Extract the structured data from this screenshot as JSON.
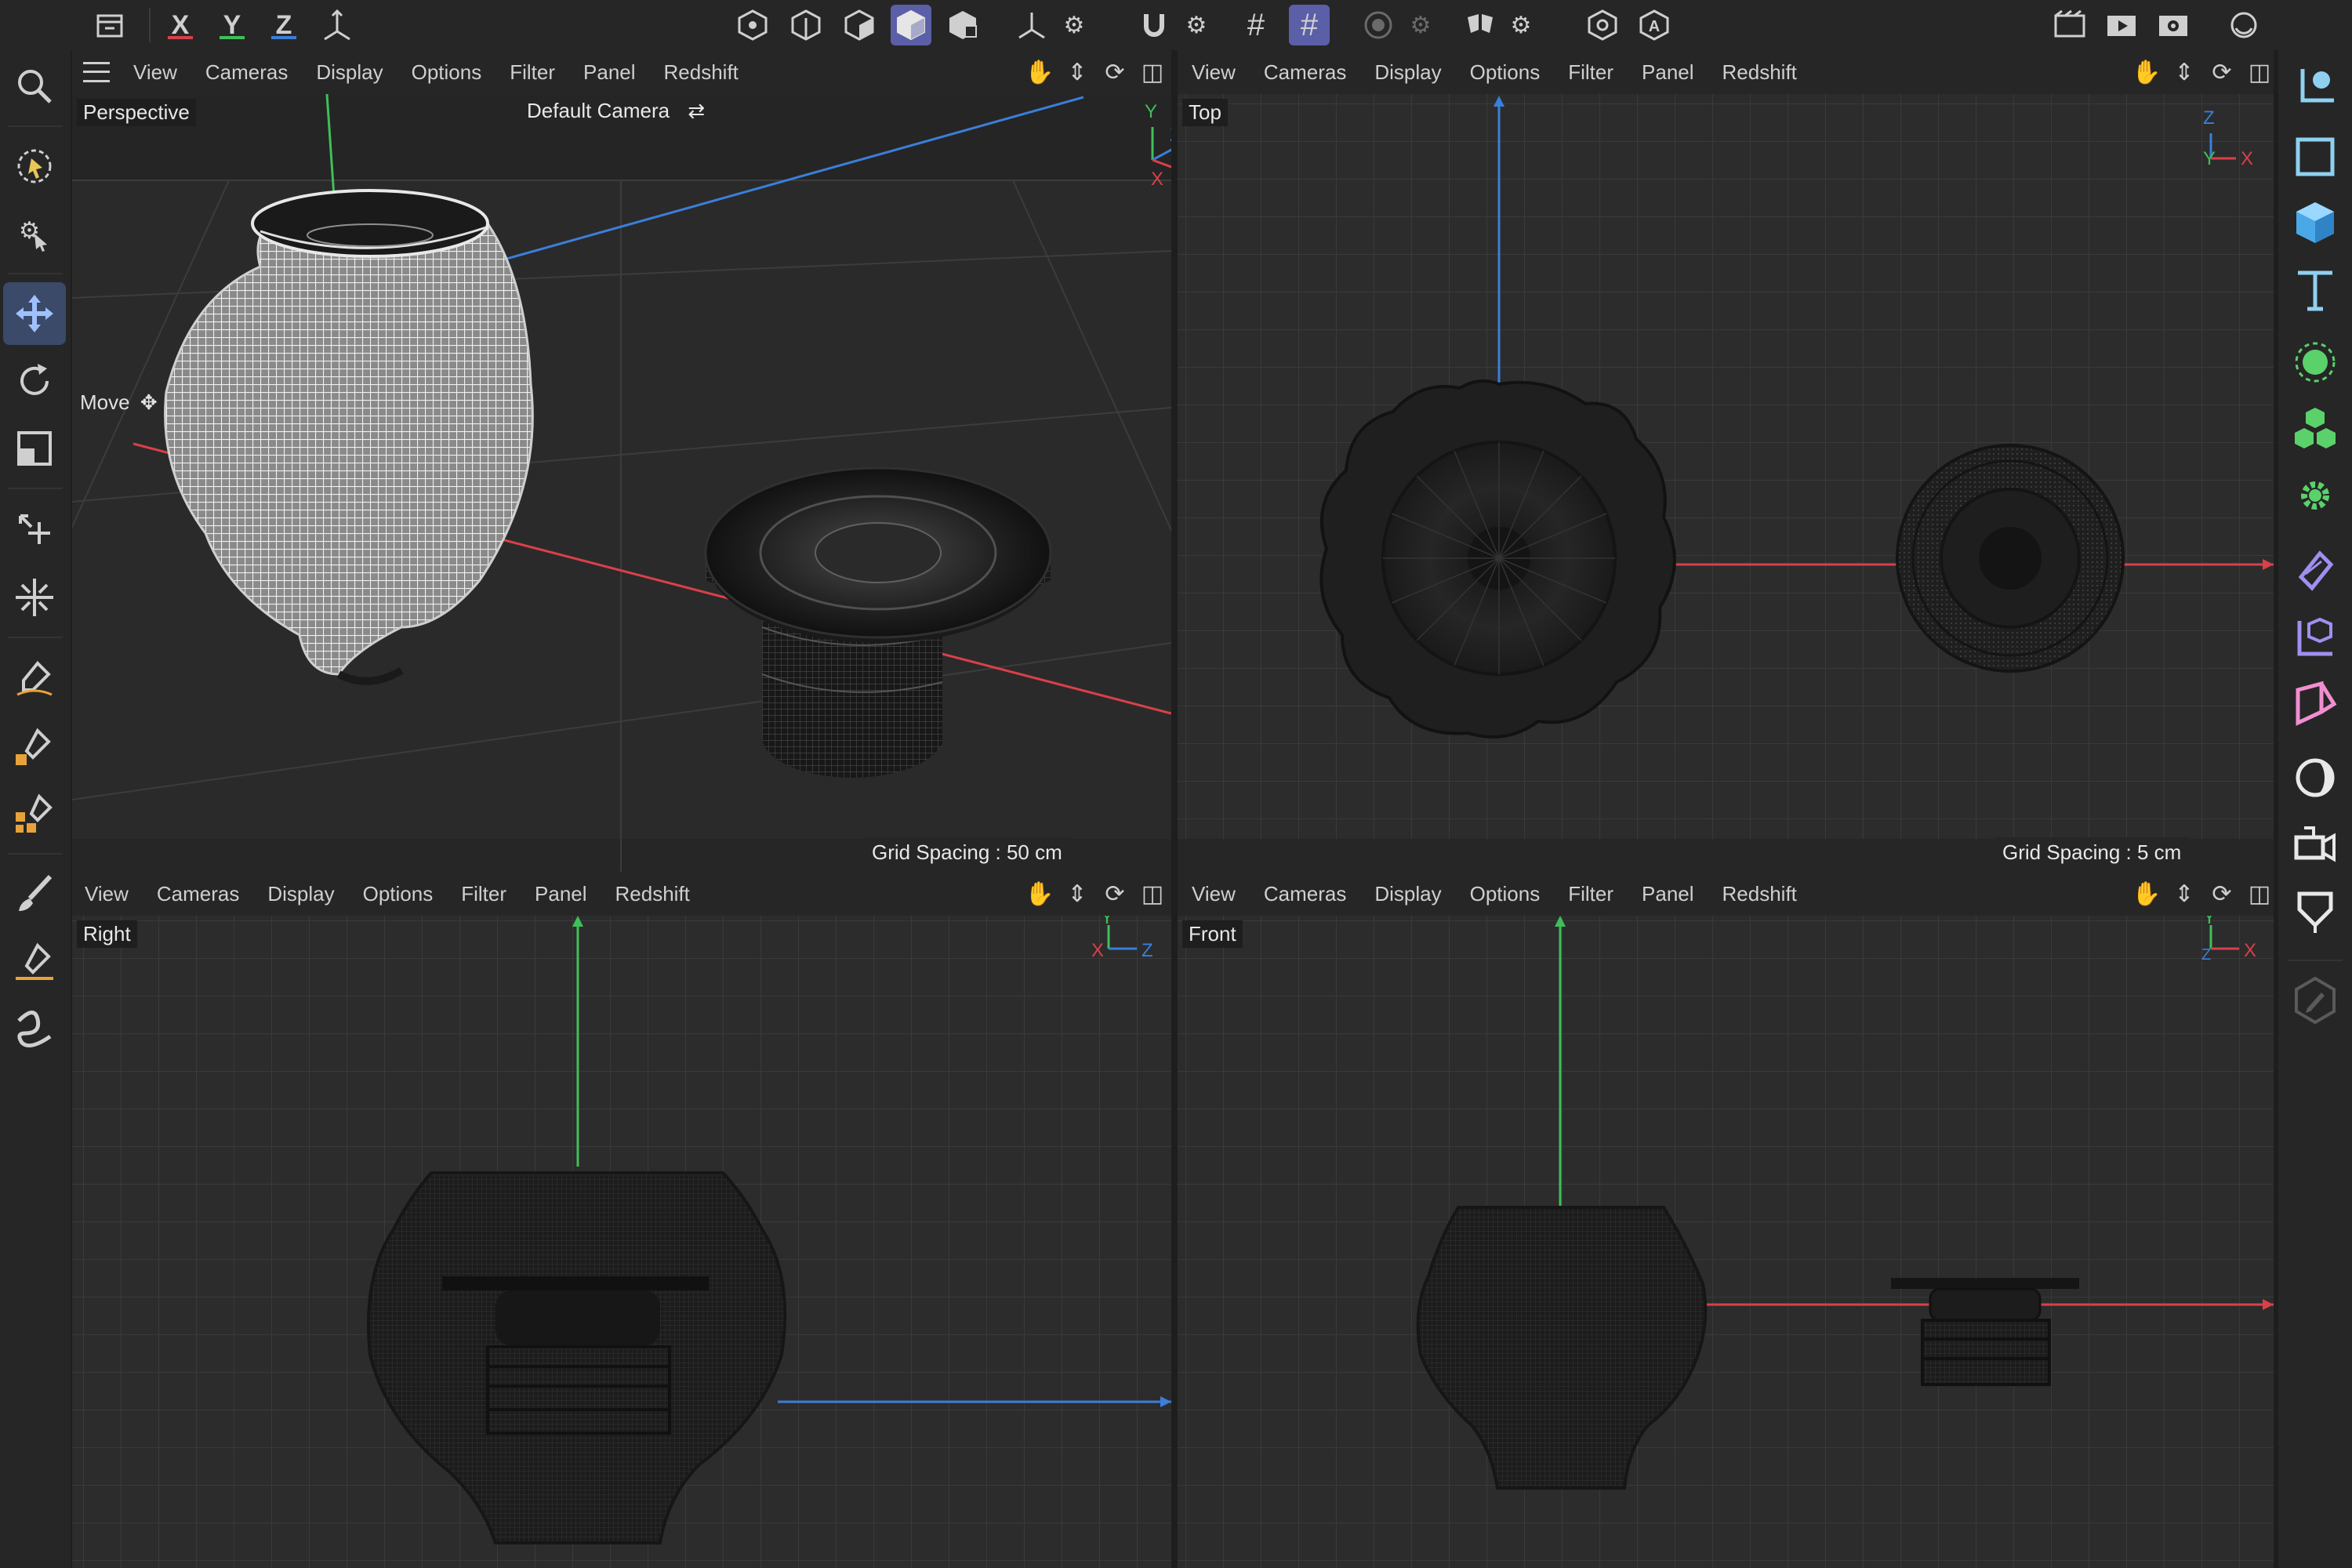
{
  "menu_items": [
    "View",
    "Cameras",
    "Display",
    "Options",
    "Filter",
    "Panel",
    "Redshift"
  ],
  "axis_labels": {
    "x": "X",
    "y": "Y",
    "z": "Z"
  },
  "viewports": {
    "perspective": {
      "label": "Perspective",
      "camera": "Default Camera",
      "grid_spacing": "Grid Spacing : 50 cm",
      "tool_hint": "Move"
    },
    "top": {
      "label": "Top",
      "grid_spacing": "Grid Spacing : 5 cm"
    },
    "right": {
      "label": "Right"
    },
    "front": {
      "label": "Front"
    }
  },
  "colors": {
    "x_axis": "#d9404a",
    "y_axis": "#3fbf5a",
    "z_axis": "#3a7fd9",
    "active_tool": "#5b5fa8",
    "viewport_bg": "#2c2c2c",
    "toolbar_bg": "#262626"
  }
}
